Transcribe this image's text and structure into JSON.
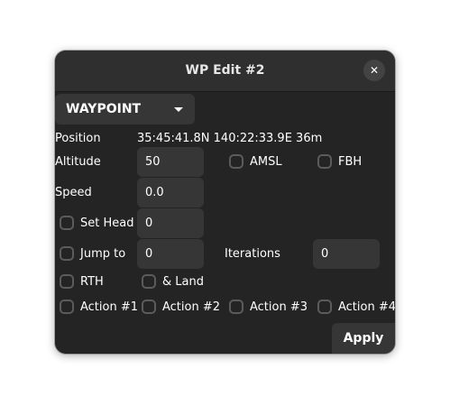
{
  "window": {
    "title": "WP Edit #2",
    "close_glyph": "✕"
  },
  "waypoint_type": {
    "selected": "WAYPOINT"
  },
  "position": {
    "label": "Position",
    "value": "35:45:41.8N 140:22:33.9E 36m"
  },
  "altitude": {
    "label": "Altitude",
    "value": "50",
    "amsl_label": "AMSL",
    "fbh_label": "FBH"
  },
  "speed": {
    "label": "Speed",
    "value": "0.0"
  },
  "set_head": {
    "label": "Set Head",
    "value": "0"
  },
  "jump_to": {
    "label": "Jump to",
    "value": "0",
    "iterations_label": "Iterations",
    "iterations_value": "0"
  },
  "rth": {
    "label": "RTH",
    "land_label": "& Land"
  },
  "actions": [
    {
      "label": "Action #1"
    },
    {
      "label": "Action #2"
    },
    {
      "label": "Action #3"
    },
    {
      "label": "Action #4"
    }
  ],
  "footer": {
    "apply_label": "Apply"
  }
}
